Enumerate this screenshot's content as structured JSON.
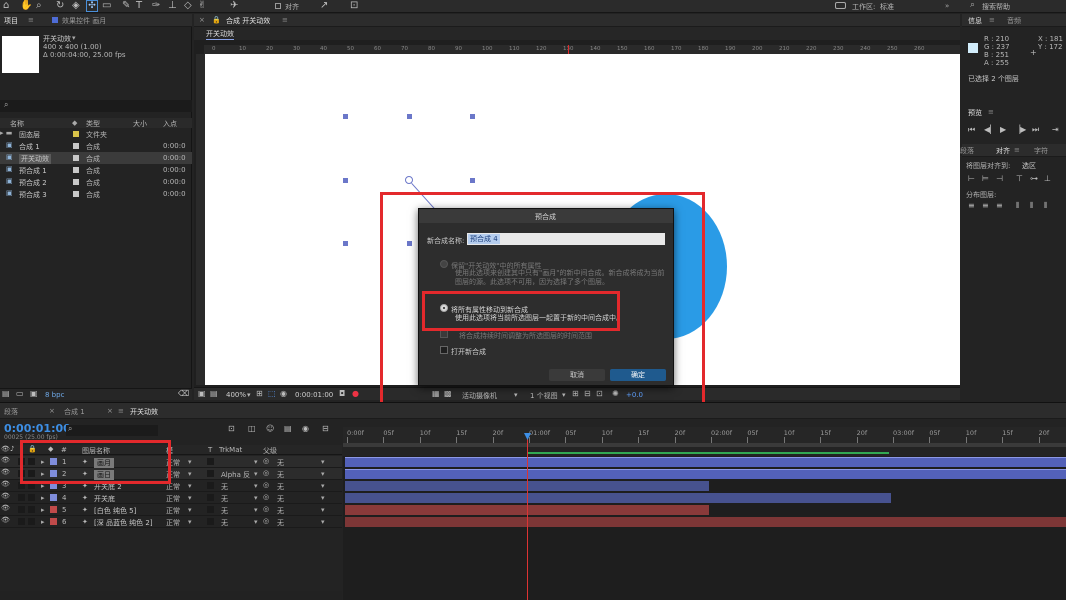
{
  "toolbar": {
    "align_label": "对齐",
    "workspace_label": "工作区:",
    "workspace_value": "标准",
    "search_help": "搜索帮助"
  },
  "project_panel": {
    "tab_project": "项目",
    "tab_effects": "效果控件 画月",
    "item_name": "开关动效",
    "item_size": "400 x 400 (1.00)",
    "item_duration": "Δ 0:00:04:00, 25.00 fps",
    "col_name": "名称",
    "col_type": "类型",
    "col_size": "大小",
    "col_in": "入点",
    "items": [
      {
        "name": "固态层",
        "type": "文件夹",
        "in": "",
        "color": "#d9c34a",
        "kind": "folder"
      },
      {
        "name": "合成 1",
        "type": "合成",
        "in": "0:00:0",
        "color": "#c8c8c8",
        "kind": "comp"
      },
      {
        "name": "开关动效",
        "type": "合成",
        "in": "0:00:0",
        "color": "#c8c8c8",
        "kind": "comp",
        "selected": true
      },
      {
        "name": "预合成 1",
        "type": "合成",
        "in": "0:00:0",
        "color": "#c8c8c8",
        "kind": "comp"
      },
      {
        "name": "预合成 2",
        "type": "合成",
        "in": "0:00:0",
        "color": "#c8c8c8",
        "kind": "comp"
      },
      {
        "name": "预合成 3",
        "type": "合成",
        "in": "0:00:0",
        "color": "#c8c8c8",
        "kind": "comp"
      }
    ],
    "bpc": "8 bpc"
  },
  "composition_panel": {
    "tab_label": "合成 开关动效",
    "comp_tab": "开关动效",
    "zoom": "400%",
    "timecode": "0:00:01:00",
    "camera": "活动摄像机",
    "views": "1 个视图",
    "exposure": "+0.0"
  },
  "dialog": {
    "title": "预合成",
    "name_label": "新合成名称:",
    "name_value": "预合成 4",
    "option1_title": "保留\"开关动效\"中的所有属性",
    "option1_desc": "使用此选项来创建其中只有\"画月\"的新中间合成。新合成将成为当前图层的源。此选项不可用，因为选择了多个图层。",
    "option2_title": "将所有属性移动到新合成",
    "option2_desc": "使用此选项将当前所选图层一起置于新的中间合成中。",
    "adjust_duration": "将合成持续时间调整为所选图层的时间范围",
    "open_new": "打开新合成",
    "cancel": "取消",
    "ok": "确定"
  },
  "info_panel": {
    "tab_info": "信息",
    "tab_audio": "音频",
    "r": "R : 210",
    "g": "G : 237",
    "b": "B : 251",
    "a": "A : 255",
    "x": "X : 181",
    "y": "Y : 172",
    "status": "已选择 2 个图层"
  },
  "preview_panel": {
    "title": "预览"
  },
  "align_panel": {
    "tab_para": "段落",
    "tab_align": "对齐",
    "tab_char": "字符",
    "align_to_label": "将图层对齐到:",
    "align_to_value": "选区",
    "distribute_label": "分布图层:"
  },
  "timeline": {
    "tab_para": "段落",
    "tab_comp1": "合成 1",
    "tab_active": "开关动效",
    "timecode": "0:00:01:00",
    "frames": "00025 (25.00 fps)",
    "col_layer_name": "图层名称",
    "col_mode": "模",
    "col_t": "T",
    "col_trkmat": "TrkMat",
    "col_parent": "父级",
    "ruler": [
      "0:00f",
      "05f",
      "10f",
      "15f",
      "20f",
      "01:00f",
      "05f",
      "10f",
      "15f",
      "20f",
      "02:00f",
      "05f",
      "10f",
      "15f",
      "20f",
      "03:00f",
      "05f",
      "10f",
      "15f",
      "20f"
    ],
    "layers": [
      {
        "num": "1",
        "name": "画月",
        "mode": "正常",
        "trkmat": "",
        "parent": "无",
        "color": "#7f8ddb",
        "boxed": true
      },
      {
        "num": "2",
        "name": "画日",
        "mode": "正常",
        "trkmat": "Alpha 反",
        "parent": "无",
        "color": "#7f8ddb",
        "boxed": true
      },
      {
        "num": "3",
        "name": "开关底 2",
        "mode": "正常",
        "trkmat": "无",
        "parent": "无",
        "color": "#7f8ddb",
        "boxed": false
      },
      {
        "num": "4",
        "name": "开关底",
        "mode": "正常",
        "trkmat": "无",
        "parent": "无",
        "color": "#7f8ddb",
        "boxed": false
      },
      {
        "num": "5",
        "name": "[白色 纯色 5]",
        "mode": "正常",
        "trkmat": "无",
        "parent": "无",
        "color": "#c04a4a",
        "boxed": false
      },
      {
        "num": "6",
        "name": "[深 品蓝色 纯色 2]",
        "mode": "正常",
        "trkmat": "无",
        "parent": "无",
        "color": "#c04a4a",
        "boxed": false
      }
    ]
  },
  "colors": {
    "accent_blue": "#2a9be6",
    "highlight_red": "#e3292c",
    "timecode_blue": "#3d8fe6"
  }
}
